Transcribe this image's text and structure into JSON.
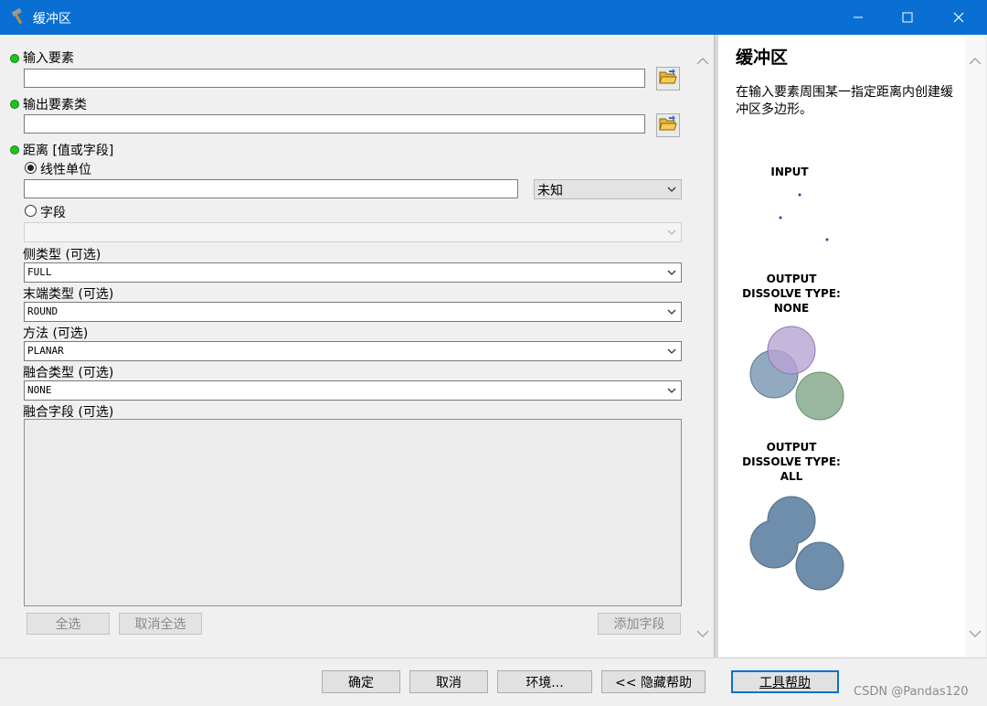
{
  "window": {
    "title": "缓冲区"
  },
  "form": {
    "input_features": {
      "label": "输入要素",
      "value": ""
    },
    "output_feature_class": {
      "label": "输出要素类",
      "value": ""
    },
    "distance": {
      "label": "距离 [值或字段]",
      "linear_unit": {
        "label": "线性单位",
        "selected": true,
        "value": "",
        "unit": "未知"
      },
      "field": {
        "label": "字段",
        "selected": false,
        "value": ""
      }
    },
    "side_type": {
      "label": "侧类型 (可选)",
      "value": "FULL"
    },
    "end_type": {
      "label": "末端类型 (可选)",
      "value": "ROUND"
    },
    "method": {
      "label": "方法 (可选)",
      "value": "PLANAR"
    },
    "dissolve_type": {
      "label": "融合类型 (可选)",
      "value": "NONE"
    },
    "dissolve_field": {
      "label": "融合字段 (可选)",
      "items": []
    },
    "buttons": {
      "select_all": "全选",
      "unselect_all": "取消全选",
      "add_field": "添加字段"
    }
  },
  "help": {
    "title": "缓冲区",
    "description": "在输入要素周围某一指定距离内创建缓冲区多边形。",
    "diagram": {
      "input_label": "INPUT",
      "output_none_label_1": "OUTPUT",
      "output_none_label_2": "DISSOLVE TYPE:",
      "output_none_label_3": "NONE",
      "output_all_label_1": "OUTPUT",
      "output_all_label_2": "DISSOLVE TYPE:",
      "output_all_label_3": "ALL"
    }
  },
  "footer": {
    "ok": "确定",
    "cancel": "取消",
    "environments": "环境...",
    "hide_help": "<< 隐藏帮助",
    "tool_help": "工具帮助"
  },
  "watermark": "CSDN @Pandas120",
  "colors": {
    "titlebar": "#0a6fd3",
    "required_dot": "#1fc21f",
    "focus_border": "#0a6fd3"
  }
}
